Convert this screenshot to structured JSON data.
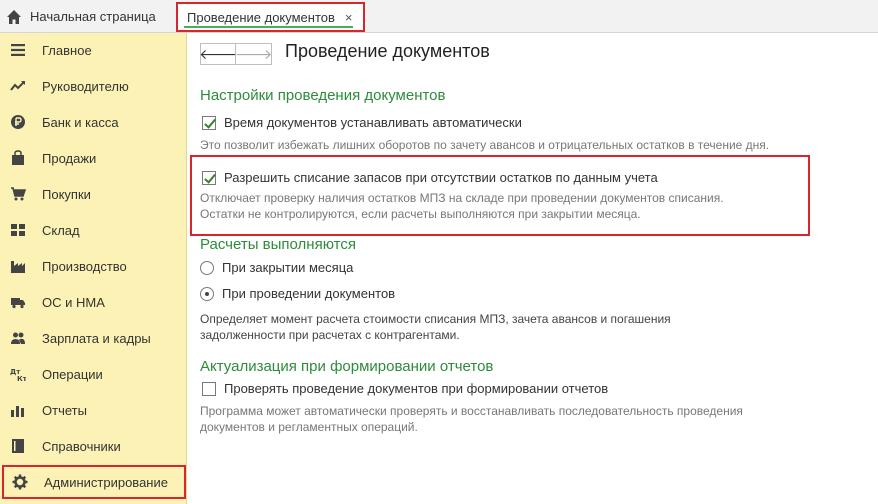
{
  "tabs": {
    "home_label": "Начальная страница",
    "active_label": "Проведение документов",
    "close_glyph": "×"
  },
  "sidebar": {
    "items": [
      {
        "label": "Главное",
        "icon": "menu-icon"
      },
      {
        "label": "Руководителю",
        "icon": "trend-icon"
      },
      {
        "label": "Банк и касса",
        "icon": "ruble-icon"
      },
      {
        "label": "Продажи",
        "icon": "bag-icon"
      },
      {
        "label": "Покупки",
        "icon": "cart-icon"
      },
      {
        "label": "Склад",
        "icon": "warehouse-icon"
      },
      {
        "label": "Производство",
        "icon": "factory-icon"
      },
      {
        "label": "ОС и НМА",
        "icon": "truck-icon"
      },
      {
        "label": "Зарплата и кадры",
        "icon": "people-icon"
      },
      {
        "label": "Операции",
        "icon": "dt-kt-icon"
      },
      {
        "label": "Отчеты",
        "icon": "bar-chart-icon"
      },
      {
        "label": "Справочники",
        "icon": "book-icon"
      },
      {
        "label": "Администрирование",
        "icon": "gear-icon"
      }
    ]
  },
  "content": {
    "back_glyph": "🡐",
    "forward_glyph": "🡒",
    "title": "Проведение документов",
    "section1": {
      "title": "Настройки проведения документов",
      "opt1_label": "Время документов устанавливать автоматически",
      "opt1_checked": true,
      "opt1_hint": "Это позволит избежать лишних оборотов по зачету авансов и отрицательных остатков в течение дня.",
      "opt2_label": "Разрешить списание запасов при отсутствии остатков по данным учета",
      "opt2_checked": true,
      "opt2_hint_line1": "Отключает проверку наличия остатков МПЗ на складе при проведении документов списания.",
      "opt2_hint_line2": "Остатки не контролируются, если расчеты выполняются при закрытии месяца."
    },
    "section2": {
      "title": "Расчеты выполняются",
      "radio1_label": "При закрытии месяца",
      "radio2_label": "При проведении документов",
      "selected": "radio2",
      "hint_line1": "Определяет момент расчета стоимости списания МПЗ, зачета авансов и погашения",
      "hint_line2": "задолженности при расчетах с контрагентами."
    },
    "section3": {
      "title": "Актуализация при формировании отчетов",
      "opt_label": "Проверять проведение документов при формировании отчетов",
      "opt_checked": false,
      "hint_line1": "Программа может автоматически проверять и восстанавливать последовательность проведения",
      "hint_line2": "документов и регламентных операций."
    }
  }
}
